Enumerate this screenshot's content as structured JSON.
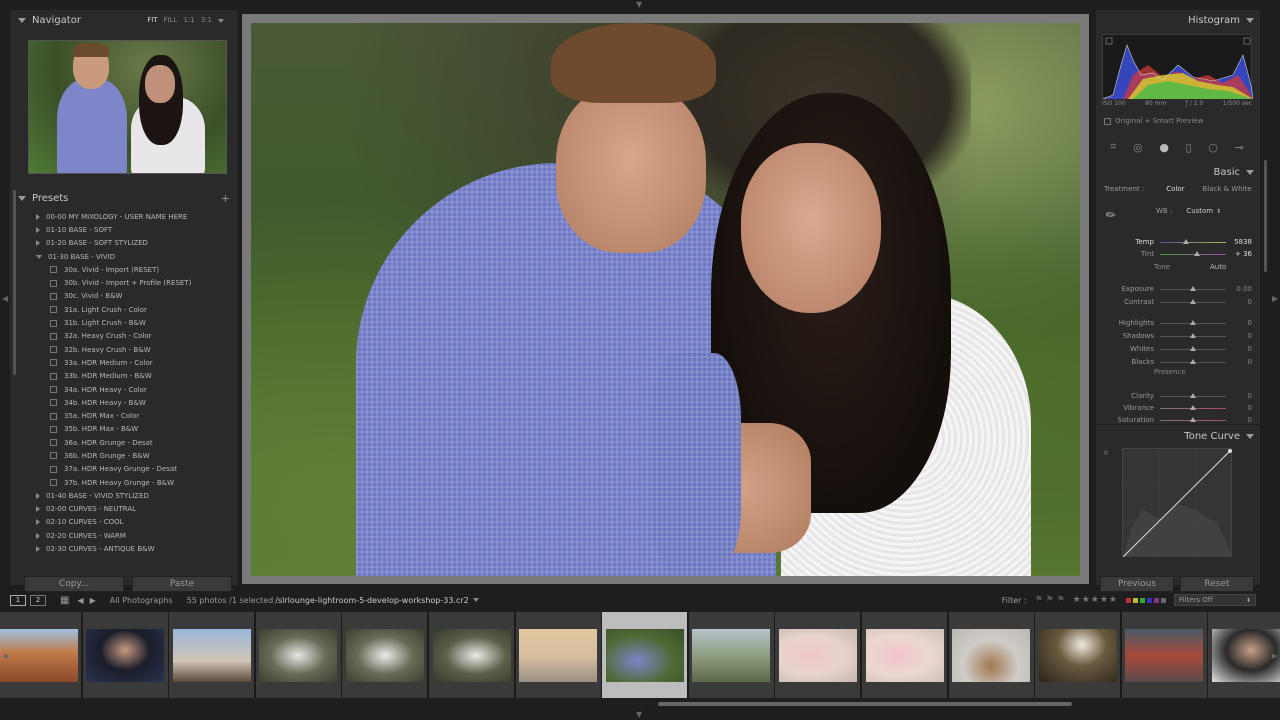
{
  "navigator": {
    "title": "Navigator",
    "zoom_options": [
      "FIT",
      "FILL",
      "1:1",
      "3:1"
    ],
    "active_zoom": "FIT"
  },
  "presets": {
    "title": "Presets",
    "add_glyph": "+",
    "items": [
      {
        "label": "00-00 MY MIXOLOGY - USER NAME HERE",
        "type": "folder",
        "open": false
      },
      {
        "label": "01-10 BASE - SOFT",
        "type": "folder",
        "open": false
      },
      {
        "label": "01-20 BASE - SOFT STYLIZED",
        "type": "folder",
        "open": false
      },
      {
        "label": "01-30 BASE - VIVID",
        "type": "folder",
        "open": true
      },
      {
        "label": "30a. Vivid - Import (RESET)",
        "type": "child"
      },
      {
        "label": "30b. Vivid - Import + Profile (RESET)",
        "type": "child"
      },
      {
        "label": "30c. Vivid - B&W",
        "type": "child"
      },
      {
        "label": "31a. Light Crush - Color",
        "type": "child"
      },
      {
        "label": "31b. Light Crush - B&W",
        "type": "child"
      },
      {
        "label": "32a. Heavy Crush - Color",
        "type": "child"
      },
      {
        "label": "32b. Heavy Crush - B&W",
        "type": "child"
      },
      {
        "label": "33a. HDR Medium - Color",
        "type": "child"
      },
      {
        "label": "33b. HDR Medium - B&W",
        "type": "child"
      },
      {
        "label": "34a. HDR Heavy - Color",
        "type": "child"
      },
      {
        "label": "34b. HDR Heavy - B&W",
        "type": "child"
      },
      {
        "label": "35a. HDR Max - Color",
        "type": "child"
      },
      {
        "label": "35b. HDR Max - B&W",
        "type": "child"
      },
      {
        "label": "36a. HDR Grunge - Desat",
        "type": "child"
      },
      {
        "label": "36b. HDR Grunge - B&W",
        "type": "child"
      },
      {
        "label": "37a. HDR Heavy Grunge - Desat",
        "type": "child"
      },
      {
        "label": "37b. HDR Heavy Grunge - B&W",
        "type": "child"
      },
      {
        "label": "01-40 BASE - VIVID STYLIZED",
        "type": "folder",
        "open": false
      },
      {
        "label": "02-00 CURVES - NEUTRAL",
        "type": "folder",
        "open": false
      },
      {
        "label": "02-10 CURVES - COOL",
        "type": "folder",
        "open": false
      },
      {
        "label": "02-20 CURVES - WARM",
        "type": "folder",
        "open": false
      },
      {
        "label": "02-30 CURVES - ANTIQUE B&W",
        "type": "folder",
        "open": false
      }
    ]
  },
  "buttons": {
    "copy": "Copy...",
    "paste": "Paste",
    "previous": "Previous",
    "reset": "Reset"
  },
  "histogram": {
    "title": "Histogram",
    "iso": "ISO 100",
    "focal": "80 mm",
    "aperture": "ƒ / 2.0",
    "shutter": "1/500 sec",
    "preview_label": "Original + Smart Preview"
  },
  "basic": {
    "title": "Basic",
    "treatment_label": "Treatment :",
    "treatment_color": "Color",
    "treatment_bw": "Black & White",
    "wb_label": "WB :",
    "wb_value": "Custom",
    "tone_label": "Tone",
    "auto_label": "Auto",
    "presence_label": "Presence",
    "sliders": [
      {
        "label": "Temp",
        "value": "5838",
        "pos": 0.4,
        "group": "wb"
      },
      {
        "label": "Tint",
        "value": "+ 36",
        "pos": 0.56,
        "group": "wb"
      },
      {
        "label": "Exposure",
        "value": "0.00",
        "pos": 0.5,
        "group": "tone"
      },
      {
        "label": "Contrast",
        "value": "0",
        "pos": 0.5,
        "group": "tone"
      },
      {
        "label": "Highlights",
        "value": "0",
        "pos": 0.5,
        "group": "tone2"
      },
      {
        "label": "Shadows",
        "value": "0",
        "pos": 0.5,
        "group": "tone2"
      },
      {
        "label": "Whites",
        "value": "0",
        "pos": 0.5,
        "group": "tone2"
      },
      {
        "label": "Blacks",
        "value": "0",
        "pos": 0.5,
        "group": "tone2"
      },
      {
        "label": "Clarity",
        "value": "0",
        "pos": 0.5,
        "group": "presence"
      },
      {
        "label": "Vibrance",
        "value": "0",
        "pos": 0.5,
        "group": "presence"
      },
      {
        "label": "Saturation",
        "value": "0",
        "pos": 0.5,
        "group": "presence"
      }
    ]
  },
  "tone_curve": {
    "title": "Tone Curve",
    "zero_label": "0"
  },
  "filmstrip_bar": {
    "monitor1": "1",
    "monitor2": "2",
    "source": "All Photographs",
    "count": "55 photos /1 selected",
    "filename": "/slrlounge-lightroom-5-develop-workshop-33.cr2",
    "filter_label": "Filter :",
    "filters_off": "Filters Off",
    "stars": "★★★★★"
  },
  "thumbnails": [
    {
      "scene": "canyon"
    },
    {
      "scene": "portrait"
    },
    {
      "scene": "sunset"
    },
    {
      "scene": "couple1"
    },
    {
      "scene": "couple2"
    },
    {
      "scene": "couple3"
    },
    {
      "scene": "beach"
    },
    {
      "scene": "couple-selected"
    },
    {
      "scene": "field"
    },
    {
      "scene": "baby1"
    },
    {
      "scene": "baby2"
    },
    {
      "scene": "basket"
    },
    {
      "scene": "forest"
    },
    {
      "scene": "group"
    },
    {
      "scene": "man"
    }
  ]
}
